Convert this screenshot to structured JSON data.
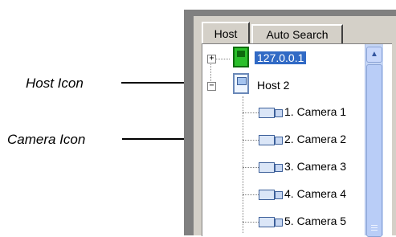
{
  "tabs": {
    "host": "Host",
    "auto_search": "Auto Search"
  },
  "tree": {
    "host1": {
      "label": "127.0.0.1",
      "expander": "+"
    },
    "host2": {
      "label": "Host 2",
      "expander": "−"
    },
    "cameras": [
      {
        "label": "1. Camera 1"
      },
      {
        "label": "2. Camera 2"
      },
      {
        "label": "3. Camera 3"
      },
      {
        "label": "4. Camera 4"
      },
      {
        "label": "5. Camera 5"
      }
    ]
  },
  "annotations": {
    "host_icon": "Host Icon",
    "camera_icon": "Camera Icon"
  },
  "icons": {
    "host": "computer-icon",
    "camera": "camera-icon",
    "scroll_up": "chevron-up-icon"
  }
}
